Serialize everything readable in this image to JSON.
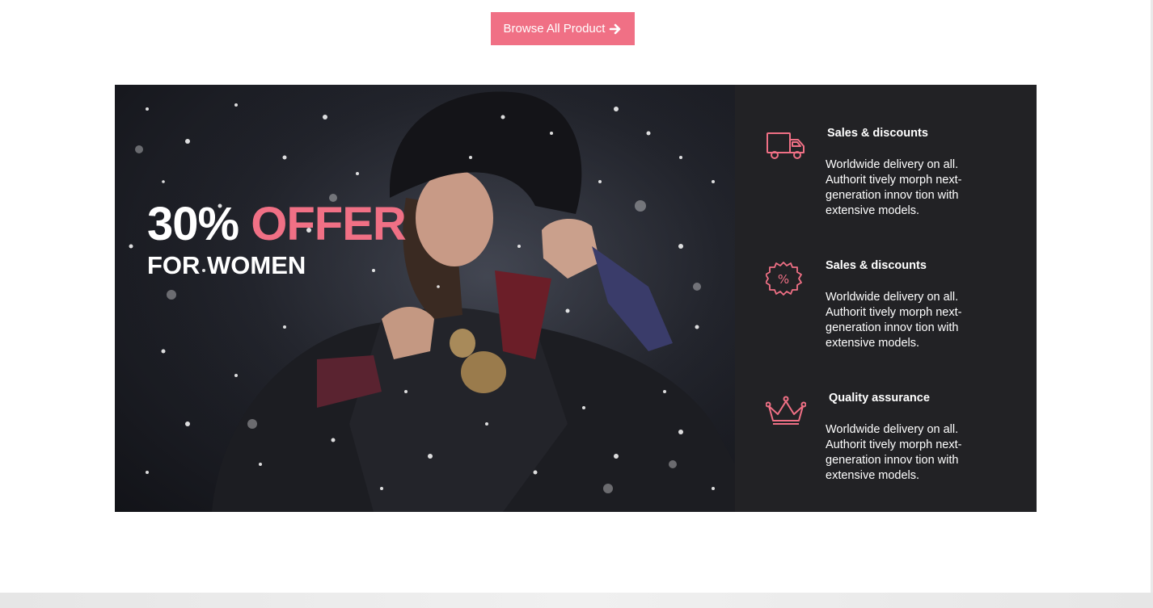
{
  "header": {
    "browse_label": "Browse All Product"
  },
  "promo": {
    "offer_percent": "30%",
    "offer_word": "OFFER",
    "subtitle": "FOR WOMEN"
  },
  "features": [
    {
      "icon": "truck-icon",
      "title": "Sales & discounts",
      "text": "Worldwide delivery on all. Authorit tively morph next-generation innov tion with extensive models."
    },
    {
      "icon": "percent-badge-icon",
      "title": "Sales & discounts",
      "text": "Worldwide delivery on all. Authorit tively morph next-generation innov tion with extensive models."
    },
    {
      "icon": "crown-icon",
      "title": "Quality assurance",
      "text": "Worldwide delivery on all. Authorit tively morph next-generation innov tion with extensive models."
    }
  ],
  "colors": {
    "accent": "#f07085",
    "panel": "#222225",
    "text": "#ffffff"
  }
}
